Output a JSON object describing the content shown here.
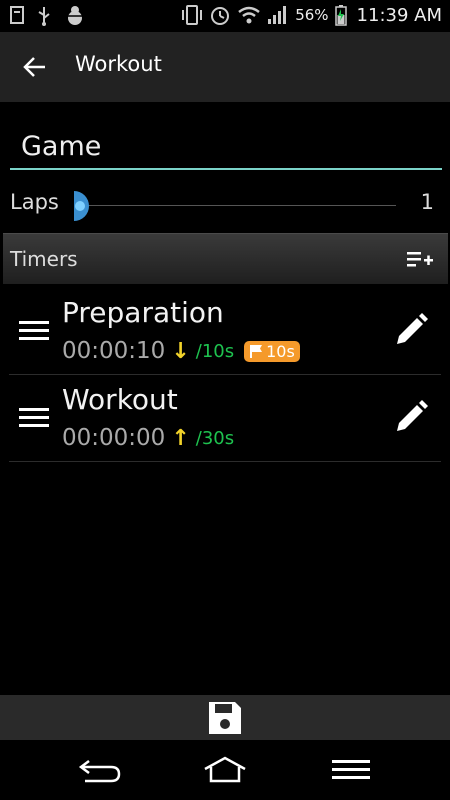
{
  "status_bar": {
    "battery": "56%",
    "time": "11:39 AM",
    "icons": [
      "usb-icon",
      "debug-icon",
      "vibrate-icon",
      "alarm-icon",
      "wifi-icon",
      "signal-icon",
      "battery-charging-icon"
    ]
  },
  "app_bar": {
    "title": "Workout",
    "back_icon": "arrow-left-icon"
  },
  "form": {
    "name_value": "Game",
    "laps_label": "Laps",
    "laps_value": "1",
    "laps_slider_fraction": 0
  },
  "timers": {
    "header_label": "Timers",
    "add_icon": "playlist-add-icon",
    "items": [
      {
        "name": "Preparation",
        "duration": "00:00:10",
        "direction": "↓",
        "lap": "/10s",
        "badge": "10s"
      },
      {
        "name": "Workout",
        "duration": "00:00:00",
        "direction": "↑",
        "lap": "/30s",
        "badge": ""
      }
    ]
  },
  "actions": {
    "save_icon": "floppy-save-icon"
  },
  "nav": {
    "icons": [
      "back-nav-icon",
      "home-nav-icon",
      "menu-nav-icon"
    ]
  },
  "colors": {
    "accent": "#7bd3c9",
    "knob": "#3a8fd0",
    "arrow": "#f2d32a",
    "green": "#1ec24f",
    "badge": "#f59a2b"
  }
}
